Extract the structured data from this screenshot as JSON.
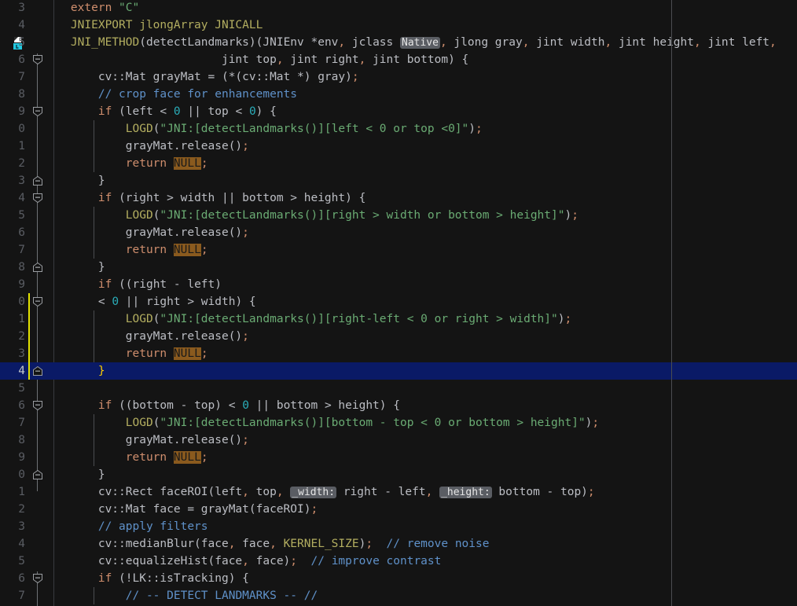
{
  "editor": {
    "theme_name": "dark",
    "colors": {
      "background": "#141414",
      "gutter_background": "#141414",
      "selection_line": "#0a1a66",
      "keyword": "#cf8e6d",
      "macro": "#b3ae60",
      "number": "#2aacb8",
      "string": "#6aab73",
      "comment": "#5f91c9",
      "identifier": "#bcbec4",
      "occurrence_highlight_bg": "#8a5a1e",
      "matched_brace": "#ffd000",
      "change_marker": "#e3e300",
      "inlay_hint_bg": "#5a5d63",
      "margin_guide": "#4b4d50"
    },
    "language": "C++",
    "selected_line_number": "4",
    "caret_line_index": 21,
    "margin_guide_column_x": 854,
    "gutter_icons": [
      {
        "line_index": 2,
        "name": "native-method-icon"
      }
    ],
    "lines": [
      {
        "num": "3",
        "indent_guides": [],
        "fold": null,
        "changed": false,
        "selected": false,
        "tokens": [
          {
            "t": "    ",
            "c": "punct"
          },
          {
            "t": "extern",
            "c": "kw"
          },
          {
            "t": " ",
            "c": "punct"
          },
          {
            "t": "\"C\"",
            "c": "str"
          }
        ]
      },
      {
        "num": "4",
        "indent_guides": [],
        "fold": null,
        "changed": false,
        "selected": false,
        "tokens": [
          {
            "t": "    ",
            "c": "punct"
          },
          {
            "t": "JNIEXPORT jlongArray JNICALL",
            "c": "macro"
          }
        ]
      },
      {
        "num": "5",
        "indent_guides": [],
        "fold": null,
        "changed": false,
        "selected": false,
        "tokens": [
          {
            "t": "    ",
            "c": "punct"
          },
          {
            "t": "JNI_METHOD",
            "c": "macro"
          },
          {
            "t": "(detectLandmarks)(",
            "c": "ident"
          },
          {
            "t": "JNIEnv",
            "c": "ident"
          },
          {
            "t": " *env",
            "c": "ident"
          },
          {
            "t": ",",
            "c": "semi"
          },
          {
            "t": " jclass ",
            "c": "ident"
          },
          {
            "t": "Native",
            "c": "hint"
          },
          {
            "t": ",",
            "c": "semi"
          },
          {
            "t": " jlong gray",
            "c": "ident"
          },
          {
            "t": ",",
            "c": "semi"
          },
          {
            "t": " jint width",
            "c": "ident"
          },
          {
            "t": ",",
            "c": "semi"
          },
          {
            "t": " jint height",
            "c": "ident"
          },
          {
            "t": ",",
            "c": "semi"
          },
          {
            "t": " jint left",
            "c": "ident"
          },
          {
            "t": ",",
            "c": "semi"
          }
        ]
      },
      {
        "num": "6",
        "indent_guides": [],
        "fold": "open",
        "changed": false,
        "selected": false,
        "tokens": [
          {
            "t": "                          jint top",
            "c": "ident"
          },
          {
            "t": ",",
            "c": "semi"
          },
          {
            "t": " jint right",
            "c": "ident"
          },
          {
            "t": ",",
            "c": "semi"
          },
          {
            "t": " jint bottom",
            "c": "ident"
          },
          {
            "t": ") {",
            "c": "punct"
          }
        ]
      },
      {
        "num": "7",
        "indent_guides": [],
        "fold": null,
        "changed": false,
        "selected": false,
        "tokens": [
          {
            "t": "        cv::Mat grayMat = (*(cv::Mat *) gray)",
            "c": "ident"
          },
          {
            "t": ";",
            "c": "semi"
          }
        ]
      },
      {
        "num": "8",
        "indent_guides": [],
        "fold": null,
        "changed": false,
        "selected": false,
        "tokens": [
          {
            "t": "        ",
            "c": "punct"
          },
          {
            "t": "// crop face for enhancements",
            "c": "cmt"
          }
        ]
      },
      {
        "num": "9",
        "indent_guides": [],
        "fold": "open",
        "changed": false,
        "selected": false,
        "tokens": [
          {
            "t": "        ",
            "c": "punct"
          },
          {
            "t": "if",
            "c": "kw"
          },
          {
            "t": " (left < ",
            "c": "ident"
          },
          {
            "t": "0",
            "c": "num"
          },
          {
            "t": " || top < ",
            "c": "ident"
          },
          {
            "t": "0",
            "c": "num"
          },
          {
            "t": ") {",
            "c": "punct"
          }
        ]
      },
      {
        "num": "0",
        "indent_guides": [
          119
        ],
        "fold": null,
        "changed": false,
        "selected": false,
        "tokens": [
          {
            "t": "            ",
            "c": "punct"
          },
          {
            "t": "LOGD",
            "c": "macro"
          },
          {
            "t": "(",
            "c": "punct"
          },
          {
            "t": "\"JNI:[detectLandmarks()][left < 0 or top <0]\"",
            "c": "str"
          },
          {
            "t": ")",
            "c": "punct"
          },
          {
            "t": ";",
            "c": "semi"
          }
        ]
      },
      {
        "num": "1",
        "indent_guides": [
          119
        ],
        "fold": null,
        "changed": false,
        "selected": false,
        "tokens": [
          {
            "t": "            grayMat.release()",
            "c": "ident"
          },
          {
            "t": ";",
            "c": "semi"
          }
        ]
      },
      {
        "num": "2",
        "indent_guides": [
          119
        ],
        "fold": null,
        "changed": false,
        "selected": false,
        "tokens": [
          {
            "t": "            ",
            "c": "punct"
          },
          {
            "t": "return",
            "c": "kw"
          },
          {
            "t": " ",
            "c": "punct"
          },
          {
            "t": "NULL",
            "c": "hl"
          },
          {
            "t": ";",
            "c": "semi"
          }
        ]
      },
      {
        "num": "3",
        "indent_guides": [],
        "fold": "close",
        "changed": false,
        "selected": false,
        "tokens": [
          {
            "t": "        }",
            "c": "punct"
          }
        ]
      },
      {
        "num": "4",
        "indent_guides": [],
        "fold": "open",
        "changed": false,
        "selected": false,
        "tokens": [
          {
            "t": "        ",
            "c": "punct"
          },
          {
            "t": "if",
            "c": "kw"
          },
          {
            "t": " (right > width || bottom > height) {",
            "c": "ident"
          }
        ]
      },
      {
        "num": "5",
        "indent_guides": [
          119
        ],
        "fold": null,
        "changed": false,
        "selected": false,
        "tokens": [
          {
            "t": "            ",
            "c": "punct"
          },
          {
            "t": "LOGD",
            "c": "macro"
          },
          {
            "t": "(",
            "c": "punct"
          },
          {
            "t": "\"JNI:[detectLandmarks()][right > width or bottom > height]\"",
            "c": "str"
          },
          {
            "t": ")",
            "c": "punct"
          },
          {
            "t": ";",
            "c": "semi"
          }
        ]
      },
      {
        "num": "6",
        "indent_guides": [
          119
        ],
        "fold": null,
        "changed": false,
        "selected": false,
        "tokens": [
          {
            "t": "            grayMat.release()",
            "c": "ident"
          },
          {
            "t": ";",
            "c": "semi"
          }
        ]
      },
      {
        "num": "7",
        "indent_guides": [
          119
        ],
        "fold": null,
        "changed": false,
        "selected": false,
        "tokens": [
          {
            "t": "            ",
            "c": "punct"
          },
          {
            "t": "return",
            "c": "kw"
          },
          {
            "t": " ",
            "c": "punct"
          },
          {
            "t": "NULL",
            "c": "hl"
          },
          {
            "t": ";",
            "c": "semi"
          }
        ]
      },
      {
        "num": "8",
        "indent_guides": [],
        "fold": "close",
        "changed": false,
        "selected": false,
        "tokens": [
          {
            "t": "        }",
            "c": "punct"
          }
        ]
      },
      {
        "num": "9",
        "indent_guides": [],
        "fold": null,
        "changed": false,
        "selected": false,
        "tokens": [
          {
            "t": "        ",
            "c": "punct"
          },
          {
            "t": "if",
            "c": "kw"
          },
          {
            "t": " ((right - left)",
            "c": "ident"
          }
        ]
      },
      {
        "num": "0",
        "indent_guides": [],
        "fold": "open",
        "changed": true,
        "selected": false,
        "tokens": [
          {
            "t": "        < ",
            "c": "ident"
          },
          {
            "t": "0",
            "c": "num"
          },
          {
            "t": " || right > width) {",
            "c": "ident"
          }
        ]
      },
      {
        "num": "1",
        "indent_guides": [
          119
        ],
        "fold": null,
        "changed": true,
        "selected": false,
        "tokens": [
          {
            "t": "            ",
            "c": "punct"
          },
          {
            "t": "LOGD",
            "c": "macro"
          },
          {
            "t": "(",
            "c": "punct"
          },
          {
            "t": "\"JNI:[detectLandmarks()][right-left < 0 or right > width]\"",
            "c": "str"
          },
          {
            "t": ")",
            "c": "punct"
          },
          {
            "t": ";",
            "c": "semi"
          }
        ]
      },
      {
        "num": "2",
        "indent_guides": [
          119
        ],
        "fold": null,
        "changed": true,
        "selected": false,
        "tokens": [
          {
            "t": "            grayMat.release()",
            "c": "ident"
          },
          {
            "t": ";",
            "c": "semi"
          }
        ]
      },
      {
        "num": "3",
        "indent_guides": [
          119
        ],
        "fold": null,
        "changed": true,
        "selected": false,
        "tokens": [
          {
            "t": "            ",
            "c": "punct"
          },
          {
            "t": "return",
            "c": "kw"
          },
          {
            "t": " ",
            "c": "punct"
          },
          {
            "t": "NULL",
            "c": "hl"
          },
          {
            "t": ";",
            "c": "semi"
          }
        ]
      },
      {
        "num": "4",
        "indent_guides": [],
        "fold": "close",
        "changed": true,
        "selected": true,
        "tokens": [
          {
            "t": "        ",
            "c": "punct"
          },
          {
            "t": "}",
            "c": "brace-m"
          }
        ]
      },
      {
        "num": "5",
        "indent_guides": [],
        "fold": null,
        "changed": false,
        "selected": false,
        "tokens": []
      },
      {
        "num": "6",
        "indent_guides": [],
        "fold": "open",
        "changed": false,
        "selected": false,
        "tokens": [
          {
            "t": "        ",
            "c": "punct"
          },
          {
            "t": "if",
            "c": "kw"
          },
          {
            "t": " ((bottom - top) < ",
            "c": "ident"
          },
          {
            "t": "0",
            "c": "num"
          },
          {
            "t": " || bottom > height) {",
            "c": "ident"
          }
        ]
      },
      {
        "num": "7",
        "indent_guides": [
          119
        ],
        "fold": null,
        "changed": false,
        "selected": false,
        "tokens": [
          {
            "t": "            ",
            "c": "punct"
          },
          {
            "t": "LOGD",
            "c": "macro"
          },
          {
            "t": "(",
            "c": "punct"
          },
          {
            "t": "\"JNI:[detectLandmarks()][bottom - top < 0 or bottom > height]\"",
            "c": "str"
          },
          {
            "t": ")",
            "c": "punct"
          },
          {
            "t": ";",
            "c": "semi"
          }
        ]
      },
      {
        "num": "8",
        "indent_guides": [
          119
        ],
        "fold": null,
        "changed": false,
        "selected": false,
        "tokens": [
          {
            "t": "            grayMat.release()",
            "c": "ident"
          },
          {
            "t": ";",
            "c": "semi"
          }
        ]
      },
      {
        "num": "9",
        "indent_guides": [
          119
        ],
        "fold": null,
        "changed": false,
        "selected": false,
        "tokens": [
          {
            "t": "            ",
            "c": "punct"
          },
          {
            "t": "return",
            "c": "kw"
          },
          {
            "t": " ",
            "c": "punct"
          },
          {
            "t": "NULL",
            "c": "hl"
          },
          {
            "t": ";",
            "c": "semi"
          }
        ]
      },
      {
        "num": "0",
        "indent_guides": [],
        "fold": "close",
        "changed": false,
        "selected": false,
        "tokens": [
          {
            "t": "        }",
            "c": "punct"
          }
        ]
      },
      {
        "num": "1",
        "indent_guides": [],
        "fold": null,
        "changed": false,
        "selected": false,
        "tokens": [
          {
            "t": "        cv::Rect faceROI(left",
            "c": "ident"
          },
          {
            "t": ",",
            "c": "semi"
          },
          {
            "t": " top",
            "c": "ident"
          },
          {
            "t": ",",
            "c": "semi"
          },
          {
            "t": " ",
            "c": "punct"
          },
          {
            "t": "_width:",
            "c": "hint"
          },
          {
            "t": " right - left",
            "c": "ident"
          },
          {
            "t": ",",
            "c": "semi"
          },
          {
            "t": " ",
            "c": "punct"
          },
          {
            "t": "_height:",
            "c": "hint"
          },
          {
            "t": " bottom - top)",
            "c": "ident"
          },
          {
            "t": ";",
            "c": "semi"
          }
        ]
      },
      {
        "num": "2",
        "indent_guides": [],
        "fold": null,
        "changed": false,
        "selected": false,
        "tokens": [
          {
            "t": "        cv::Mat face = grayMat(faceROI)",
            "c": "ident"
          },
          {
            "t": ";",
            "c": "semi"
          }
        ]
      },
      {
        "num": "3",
        "indent_guides": [],
        "fold": null,
        "changed": false,
        "selected": false,
        "tokens": [
          {
            "t": "        ",
            "c": "punct"
          },
          {
            "t": "// apply filters",
            "c": "cmt"
          }
        ]
      },
      {
        "num": "4",
        "indent_guides": [],
        "fold": null,
        "changed": false,
        "selected": false,
        "tokens": [
          {
            "t": "        cv::medianBlur(face",
            "c": "ident"
          },
          {
            "t": ",",
            "c": "semi"
          },
          {
            "t": " face",
            "c": "ident"
          },
          {
            "t": ",",
            "c": "semi"
          },
          {
            "t": " ",
            "c": "punct"
          },
          {
            "t": "KERNEL_SIZE",
            "c": "macro"
          },
          {
            "t": ")",
            "c": "punct"
          },
          {
            "t": ";",
            "c": "semi"
          },
          {
            "t": "  ",
            "c": "punct"
          },
          {
            "t": "// remove noise",
            "c": "cmt"
          }
        ]
      },
      {
        "num": "5",
        "indent_guides": [],
        "fold": null,
        "changed": false,
        "selected": false,
        "tokens": [
          {
            "t": "        cv::equalizeHist(face",
            "c": "ident"
          },
          {
            "t": ",",
            "c": "semi"
          },
          {
            "t": " face)",
            "c": "ident"
          },
          {
            "t": ";",
            "c": "semi"
          },
          {
            "t": "  ",
            "c": "punct"
          },
          {
            "t": "// improve contrast",
            "c": "cmt"
          }
        ]
      },
      {
        "num": "6",
        "indent_guides": [],
        "fold": "open",
        "changed": false,
        "selected": false,
        "tokens": [
          {
            "t": "        ",
            "c": "punct"
          },
          {
            "t": "if",
            "c": "kw"
          },
          {
            "t": " (!LK::isTracking) {",
            "c": "ident"
          }
        ]
      },
      {
        "num": "7",
        "indent_guides": [
          119
        ],
        "fold": null,
        "changed": false,
        "selected": false,
        "tokens": [
          {
            "t": "            ",
            "c": "punct"
          },
          {
            "t": "// -- DETECT LANDMARKS -- //",
            "c": "cmt"
          }
        ]
      }
    ]
  }
}
